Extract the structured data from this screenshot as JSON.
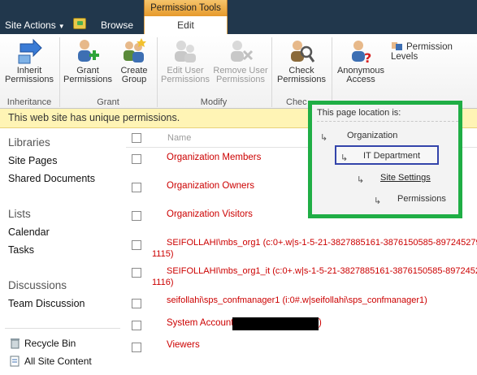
{
  "topbar": {
    "site_actions": "Site Actions",
    "tabs": {
      "browse": "Browse",
      "edit": "Edit"
    },
    "context_group": "Permission Tools"
  },
  "ribbon": {
    "buttons": {
      "inherit": "Inherit Permissions",
      "grant": "Grant Permissions",
      "create_group": "Create Group",
      "edit_user": "Edit User Permissions",
      "remove_user": "Remove User Permissions",
      "check": "Check Permissions",
      "anonymous": "Anonymous Access",
      "permission_levels": "Permission Levels"
    },
    "groups": {
      "inheritance": "Inheritance",
      "grant": "Grant",
      "modify": "Modify",
      "check": "Chec"
    }
  },
  "notice": "This web site has unique permissions.",
  "nav": {
    "libraries": "Libraries",
    "site_pages": "Site Pages",
    "shared_documents": "Shared Documents",
    "lists": "Lists",
    "calendar": "Calendar",
    "tasks": "Tasks",
    "discussions": "Discussions",
    "team_discussion": "Team Discussion",
    "recycle_bin": "Recycle Bin",
    "all_site_content": "All Site Content"
  },
  "list": {
    "header_name": "Name",
    "rows": {
      "r1": "Organization Members",
      "r2": "Organization Owners",
      "r3": "Organization Visitors",
      "r4": "SEIFOLLAHI\\mbs_org1 (c:0+.w|s-1-5-21-3827885161-3876150585-897245279",
      "r4b": "1115)",
      "r5": "SEIFOLLAHI\\mbs_org1_it (c:0+.w|s-1-5-21-3827885161-3876150585-8972452",
      "r5b": "1116)",
      "r6": "seifollahi\\sps_confmanager1 (i:0#.w|seifollahi\\sps_confmanager1)",
      "r7": "System Account",
      "r7b": ")",
      "r8": "Viewers"
    }
  },
  "popup": {
    "title": "This page location is:",
    "organization": "Organization",
    "it_department": "IT Department",
    "site_settings": "Site Settings",
    "permissions": "Permissions"
  },
  "colors": {
    "topbar": "#21374c",
    "link_red": "#cc0000",
    "notice_bg": "#fff4b5",
    "popup_border": "#1fae45",
    "current_border": "#3344aa"
  }
}
